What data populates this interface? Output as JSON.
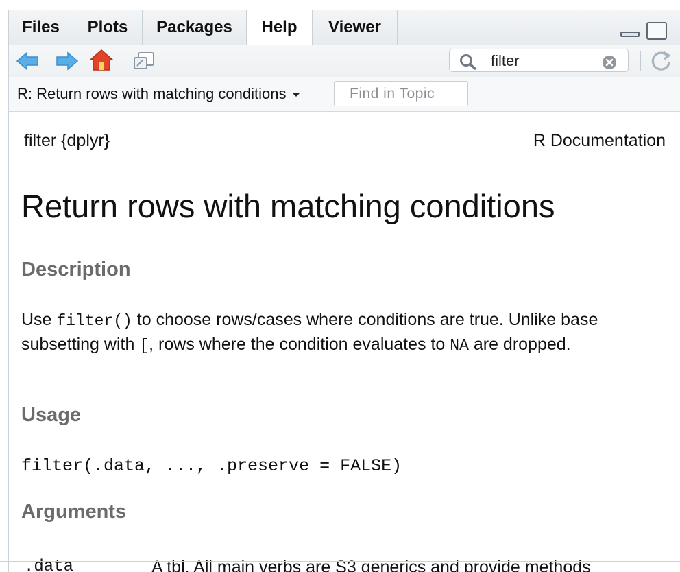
{
  "tabs": [
    {
      "label": "Files",
      "active": false
    },
    {
      "label": "Plots",
      "active": false
    },
    {
      "label": "Packages",
      "active": false
    },
    {
      "label": "Help",
      "active": true
    },
    {
      "label": "Viewer",
      "active": false
    }
  ],
  "toolbar": {
    "icons": [
      "back-arrow-icon",
      "forward-arrow-icon",
      "home-icon",
      "show-in-new-window-icon",
      "refresh-icon"
    ],
    "search": {
      "value": "filter",
      "icon": "search-icon",
      "clear_icon": "clear-icon"
    }
  },
  "topic_bar": {
    "title": "R: Return rows with matching conditions",
    "find_placeholder": "Find in Topic"
  },
  "doc": {
    "package_header": "filter {dplyr}",
    "r_documentation": "R Documentation",
    "title": "Return rows with matching conditions",
    "description_heading": "Description",
    "description": {
      "p1": "Use ",
      "code1": "filter()",
      "p2": " to choose rows/cases where conditions are true. Unlike base subsetting with ",
      "code2": "[",
      "p3": ", rows where the condition evaluates to ",
      "code3": "NA",
      "p4": " are dropped."
    },
    "usage_heading": "Usage",
    "usage_code": "filter(.data, ..., .preserve = FALSE)",
    "arguments_heading": "Arguments",
    "arguments": [
      {
        "name": ".data",
        "description": "A tbl. All main verbs are S3 generics and provide methods"
      }
    ]
  },
  "colors": {
    "arrow_blue": "#5aaee8",
    "home_red": "#e0452b",
    "heading_gray": "#6b6b6b"
  }
}
